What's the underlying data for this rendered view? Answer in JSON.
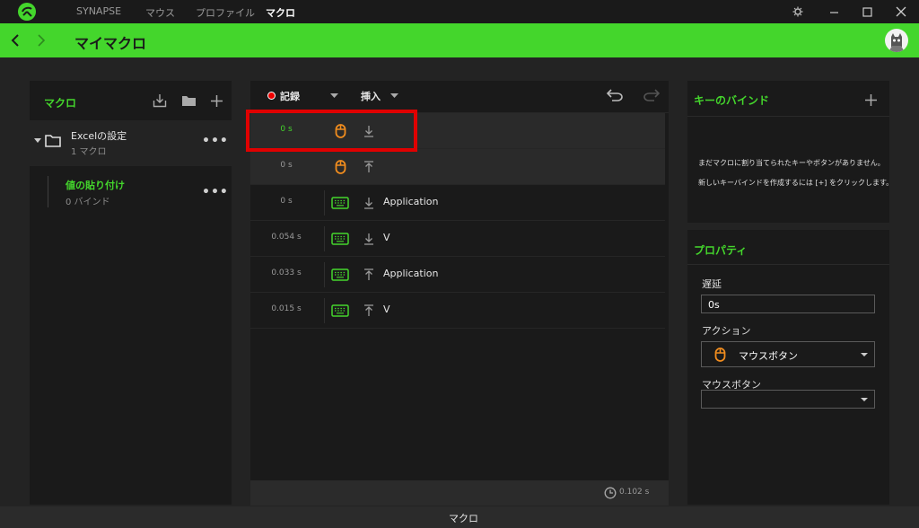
{
  "titlebar": {
    "tabs": [
      {
        "label": "SYNAPSE",
        "active": false
      },
      {
        "label": "マウス",
        "active": false
      },
      {
        "label": "プロファイル",
        "active": false
      },
      {
        "label": "マクロ",
        "active": true
      }
    ]
  },
  "header": {
    "title": "マイマクロ"
  },
  "macros_panel": {
    "title": "マクロ",
    "folder": {
      "name": "Excelの設定",
      "count": "1 マクロ"
    },
    "macro": {
      "name": "値の貼り付け",
      "binds": "0 バインド"
    },
    "more": "•••"
  },
  "editor": {
    "record_label": "記録",
    "insert_label": "挿入",
    "rows": [
      {
        "time": "0 s",
        "device": "mouse",
        "direction": "down",
        "label": "",
        "selected": true
      },
      {
        "time": "0 s",
        "device": "mouse",
        "direction": "up",
        "label": "",
        "selected": true
      },
      {
        "time": "0 s",
        "device": "keyboard",
        "direction": "down",
        "label": "Application",
        "selected": false
      },
      {
        "time": "0.054 s",
        "device": "keyboard",
        "direction": "down",
        "label": "V",
        "selected": false
      },
      {
        "time": "0.033 s",
        "device": "keyboard",
        "direction": "up",
        "label": "Application",
        "selected": false
      },
      {
        "time": "0.015 s",
        "device": "keyboard",
        "direction": "up",
        "label": "V",
        "selected": false
      }
    ],
    "total_time": "0.102 s"
  },
  "keybind_panel": {
    "title": "キーのバインド",
    "empty_line1": "まだマクロに割り当てられたキーやボタンがありません。",
    "empty_line2": "新しいキーバインドを作成するには [+] をクリックします。"
  },
  "properties": {
    "title": "プロパティ",
    "delay_label": "遅延",
    "delay_value": "0s",
    "action_label": "アクション",
    "action_value": "マウスボタン",
    "mouse_button_label": "マウスボタン",
    "mouse_button_value": ""
  },
  "footer": {
    "label": "マクロ"
  },
  "colors": {
    "accent": "#44d62c",
    "mouse_icon": "#f08c1e",
    "highlight_box": "#e00000"
  }
}
